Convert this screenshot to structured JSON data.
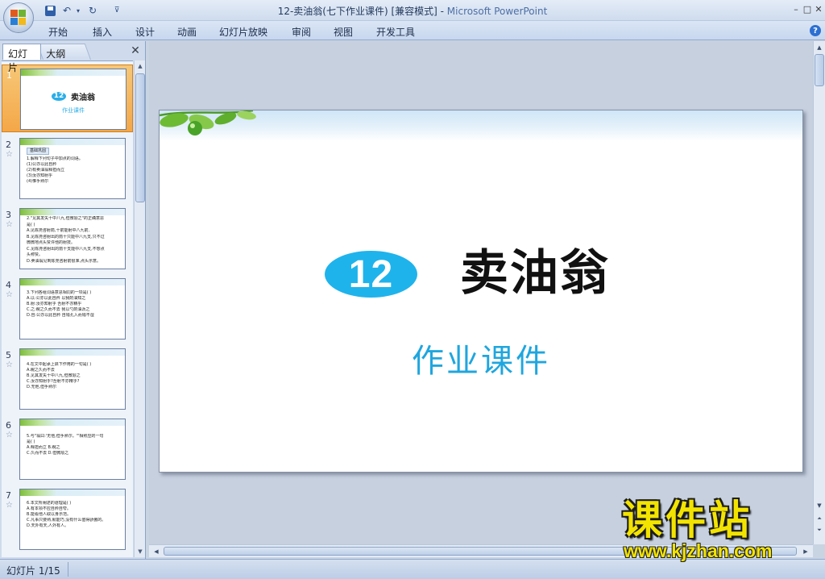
{
  "window": {
    "title": "12-卖油翁(七下作业课件) [兼容模式] - ",
    "app_name": "Microsoft PowerPoint",
    "minimize": "–",
    "maximize": "□",
    "close": "✕"
  },
  "qat": {
    "undo_dropdown": "▾",
    "customize": "⊽"
  },
  "ribbon": {
    "tabs": [
      "开始",
      "插入",
      "设计",
      "动画",
      "幻灯片放映",
      "审阅",
      "视图",
      "开发工具"
    ],
    "help": "?"
  },
  "left_pane": {
    "tabs": {
      "slides": "幻灯片",
      "outline": "大纲"
    },
    "close": "✕",
    "thumbnails": [
      {
        "number": "1",
        "star": "",
        "title_num": "12",
        "title": "卖油翁",
        "subtitle": "作业课件"
      },
      {
        "number": "2",
        "star": "☆",
        "badge": "基础巩固",
        "lines": [
          "1.解释下列句子中加点的词语。",
          "(1)公亦以此自矜",
          "(2)有卖油翁释担而立",
          "(3)汝亦知射乎",
          "(4)惟手熟尔"
        ]
      },
      {
        "number": "3",
        "star": "☆",
        "lines": [
          "2.\"见其发矢十中八九,但微颔之\"的正确意思",
          "是(    )",
          "A.见陈尧咨射箭,十箭能射中八九箭,",
          "B.见陈尧咨射出的箭十只能中八九支,只不过",
          "微微地点头赞许他的射技。",
          "C.见陈尧咨射出的箭十支能中八九支,不想点",
          "头称赞。",
          "D.卖油翁见到陈尧咨射箭很准,点头示意。"
        ]
      },
      {
        "number": "4",
        "star": "☆",
        "lines": [
          "3.下列各组词语意思相同的一项是(    )",
          "A.以:公亦以此自矜        以我酌油知之",
          "B.射:汝亦知射乎          吾射不亦精乎",
          "C.之:睨之久而不去        我以勺酌油沥之",
          "D.自:公亦以此自矜        自钱孔入而钱不湿"
        ]
      },
      {
        "number": "5",
        "star": "☆",
        "lines": [
          "4.在文中起承上启下作用的一句是(    )",
          "A.睨之久而不去",
          "B.见其发矢十中八九,但微颔之",
          "C.汝亦知射乎?吾射不亦精乎?",
          "D.无他,但手熟尔"
        ]
      },
      {
        "number": "6",
        "star": "☆",
        "lines": [
          "5.与\"翁曰:'无他,但手熟尔。'\"相照应的一句",
          "是(    )",
          "A.释担而立            B.睨之",
          "C.久而不去            D.但微颔之"
        ]
      },
      {
        "number": "7",
        "star": "☆",
        "lines": [
          "6.本文所阐述的道理是(    )",
          "A.有本领不应自矜自夸。",
          "B.能看他人取以身示范。",
          "C.凡事只要熟,就能巧,没有什么值得骄傲的。",
          "D.天外有天,人外有人。"
        ]
      }
    ]
  },
  "slide": {
    "number": "12",
    "title": "卖油翁",
    "subtitle": "作业课件"
  },
  "watermark": {
    "main": "课件站",
    "url": "www.kjzhan.com"
  },
  "status": {
    "slide_indicator": "幻灯片 1/15"
  },
  "colors": {
    "accent_blue": "#1fb3ec",
    "selected_thumb": "#f4a748",
    "watermark_yellow": "#f3e400"
  }
}
